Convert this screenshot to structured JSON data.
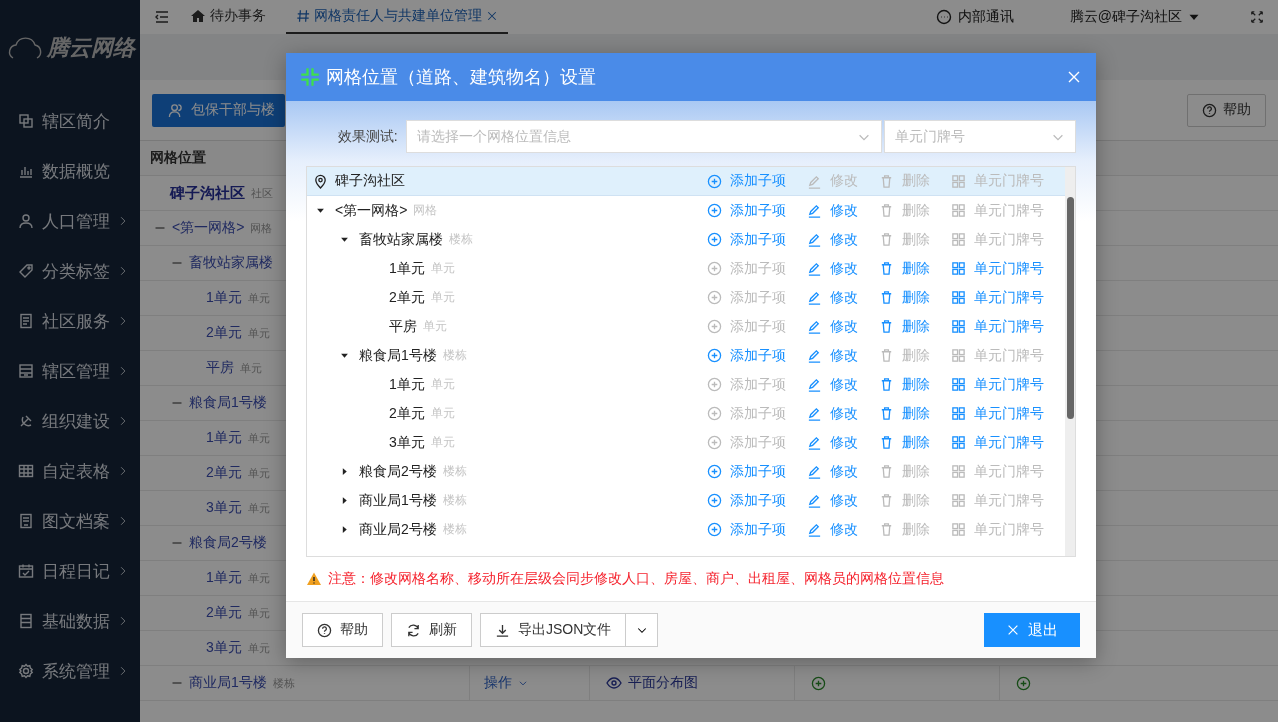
{
  "sidebar": {
    "logo": "腾云网络",
    "items": [
      {
        "label": "辖区简介",
        "has_submenu": false
      },
      {
        "label": "数据概览",
        "has_submenu": false
      },
      {
        "label": "人口管理",
        "has_submenu": true
      },
      {
        "label": "分类标签",
        "has_submenu": true
      },
      {
        "label": "社区服务",
        "has_submenu": true
      },
      {
        "label": "辖区管理",
        "has_submenu": true
      },
      {
        "label": "组织建设",
        "has_submenu": true
      },
      {
        "label": "自定表格",
        "has_submenu": true
      },
      {
        "label": "图文档案",
        "has_submenu": true
      },
      {
        "label": "日程日记",
        "has_submenu": true
      },
      {
        "label": "基础数据",
        "has_submenu": true
      },
      {
        "label": "系统管理",
        "has_submenu": true
      }
    ]
  },
  "topbar": {
    "tabs": [
      {
        "label": "待办事务",
        "kind": "home",
        "selected": false,
        "closable": false
      },
      {
        "label": "网格责任人与共建单位管理",
        "kind": "page",
        "selected": true,
        "closable": true
      }
    ],
    "messages": "内部通讯",
    "user": "腾云@碑子沟社区"
  },
  "toolbar": {
    "primary_button": "包保干部与楼",
    "help_button": "帮助"
  },
  "table": {
    "column_1": "网格位置",
    "rows": [
      {
        "name": "碑子沟社区",
        "type": "社区",
        "children": [
          {
            "name": "<第一网格>",
            "type": "网格",
            "expanded": true,
            "children": [
              {
                "name": "畜牧站家属楼",
                "expanded": true,
                "children": [
                  {
                    "name": "1单元",
                    "type": "单元"
                  },
                  {
                    "name": "2单元",
                    "type": "单元"
                  },
                  {
                    "name": "平房",
                    "type": "单元"
                  }
                ]
              },
              {
                "name": "粮食局1号楼",
                "expanded": true,
                "children": [
                  {
                    "name": "1单元",
                    "type": "单元"
                  },
                  {
                    "name": "2单元",
                    "type": "单元"
                  },
                  {
                    "name": "3单元",
                    "type": "单元"
                  }
                ]
              },
              {
                "name": "粮食局2号楼",
                "expanded": true,
                "children": [
                  {
                    "name": "1单元",
                    "type": "单元"
                  },
                  {
                    "name": "2单元",
                    "type": "单元"
                  },
                  {
                    "name": "3单元",
                    "type": "单元"
                  }
                ]
              },
              {
                "name": "商业局1号楼",
                "type": "楼栋",
                "expanded": true,
                "operation": "操作",
                "view": "平面分布图"
              }
            ]
          }
        ]
      }
    ]
  },
  "dialog": {
    "title": "网格位置（道路、建筑物名）设置",
    "test_label": "效果测试:",
    "location_select": {
      "placeholder": "请选择一个网格位置信息"
    },
    "unit_select": {
      "placeholder": "单元门牌号"
    },
    "tree": [
      {
        "name": "碑子沟社区",
        "selected": true,
        "actions": [
          {
            "label": "添加子项",
            "enabled": true
          },
          {
            "label": "修改",
            "enabled": false
          },
          {
            "label": "删除",
            "enabled": false
          },
          {
            "label": "单元门牌号",
            "enabled": false
          }
        ],
        "children": [
          {
            "name": "<第一网格>",
            "type": "网格",
            "expanded": true,
            "selected": false,
            "actions": [
              {
                "label": "添加子项",
                "enabled": true
              },
              {
                "label": "修改",
                "enabled": true
              },
              {
                "label": "删除",
                "enabled": false
              },
              {
                "label": "单元门牌号",
                "enabled": false
              }
            ],
            "children": [
              {
                "name": "畜牧站家属楼",
                "type": "楼栋",
                "expanded": true,
                "selected": false,
                "actions": [
                  {
                    "label": "添加子项",
                    "enabled": true
                  },
                  {
                    "label": "修改",
                    "enabled": true
                  },
                  {
                    "label": "删除",
                    "enabled": false
                  },
                  {
                    "label": "单元门牌号",
                    "enabled": false
                  }
                ],
                "children": [
                  {
                    "name": "1单元",
                    "type": "单元",
                    "selected": false,
                    "actions": [
                      {
                        "label": "添加子项",
                        "enabled": false
                      },
                      {
                        "label": "修改",
                        "enabled": true
                      },
                      {
                        "label": "删除",
                        "enabled": true
                      },
                      {
                        "label": "单元门牌号",
                        "enabled": true
                      }
                    ]
                  },
                  {
                    "name": "2单元",
                    "type": "单元",
                    "selected": false,
                    "actions": [
                      {
                        "label": "添加子项",
                        "enabled": false
                      },
                      {
                        "label": "修改",
                        "enabled": true
                      },
                      {
                        "label": "删除",
                        "enabled": true
                      },
                      {
                        "label": "单元门牌号",
                        "enabled": true
                      }
                    ]
                  },
                  {
                    "name": "平房",
                    "type": "单元",
                    "selected": false,
                    "actions": [
                      {
                        "label": "添加子项",
                        "enabled": false
                      },
                      {
                        "label": "修改",
                        "enabled": true
                      },
                      {
                        "label": "删除",
                        "enabled": true
                      },
                      {
                        "label": "单元门牌号",
                        "enabled": true
                      }
                    ]
                  }
                ]
              },
              {
                "name": "粮食局1号楼",
                "type": "楼栋",
                "expanded": true,
                "selected": false,
                "actions": [
                  {
                    "label": "添加子项",
                    "enabled": true
                  },
                  {
                    "label": "修改",
                    "enabled": true
                  },
                  {
                    "label": "删除",
                    "enabled": false
                  },
                  {
                    "label": "单元门牌号",
                    "enabled": false
                  }
                ],
                "children": [
                  {
                    "name": "1单元",
                    "type": "单元",
                    "selected": false,
                    "actions": [
                      {
                        "label": "添加子项",
                        "enabled": false
                      },
                      {
                        "label": "修改",
                        "enabled": true
                      },
                      {
                        "label": "删除",
                        "enabled": true
                      },
                      {
                        "label": "单元门牌号",
                        "enabled": true
                      }
                    ]
                  },
                  {
                    "name": "2单元",
                    "type": "单元",
                    "selected": false,
                    "actions": [
                      {
                        "label": "添加子项",
                        "enabled": false
                      },
                      {
                        "label": "修改",
                        "enabled": true
                      },
                      {
                        "label": "删除",
                        "enabled": true
                      },
                      {
                        "label": "单元门牌号",
                        "enabled": true
                      }
                    ]
                  },
                  {
                    "name": "3单元",
                    "type": "单元",
                    "selected": false,
                    "actions": [
                      {
                        "label": "添加子项",
                        "enabled": false
                      },
                      {
                        "label": "修改",
                        "enabled": true
                      },
                      {
                        "label": "删除",
                        "enabled": true
                      },
                      {
                        "label": "单元门牌号",
                        "enabled": true
                      }
                    ]
                  }
                ]
              },
              {
                "name": "粮食局2号楼",
                "type": "楼栋",
                "expanded": false,
                "selected": false,
                "actions": [
                  {
                    "label": "添加子项",
                    "enabled": true
                  },
                  {
                    "label": "修改",
                    "enabled": true
                  },
                  {
                    "label": "删除",
                    "enabled": false
                  },
                  {
                    "label": "单元门牌号",
                    "enabled": false
                  }
                ]
              },
              {
                "name": "商业局1号楼",
                "type": "楼栋",
                "expanded": false,
                "selected": false,
                "actions": [
                  {
                    "label": "添加子项",
                    "enabled": true
                  },
                  {
                    "label": "修改",
                    "enabled": true
                  },
                  {
                    "label": "删除",
                    "enabled": false
                  },
                  {
                    "label": "单元门牌号",
                    "enabled": false
                  }
                ]
              },
              {
                "name": "商业局2号楼",
                "type": "楼栋",
                "expanded": false,
                "selected": false,
                "actions": [
                  {
                    "label": "添加子项",
                    "enabled": true
                  },
                  {
                    "label": "修改",
                    "enabled": true
                  },
                  {
                    "label": "删除",
                    "enabled": false
                  },
                  {
                    "label": "单元门牌号",
                    "enabled": false
                  }
                ]
              }
            ]
          }
        ]
      }
    ],
    "warning": "注意：修改网格名称、移动所在层级会同步修改人口、房屋、商户、出租屋、网格员的网格位置信息",
    "buttons": [
      {
        "label": "帮助",
        "kind": "help"
      },
      {
        "label": "刷新",
        "kind": "refresh"
      },
      {
        "label": "导出JSON文件",
        "kind": "export"
      },
      {
        "label": "退出",
        "kind": "exit"
      }
    ]
  }
}
